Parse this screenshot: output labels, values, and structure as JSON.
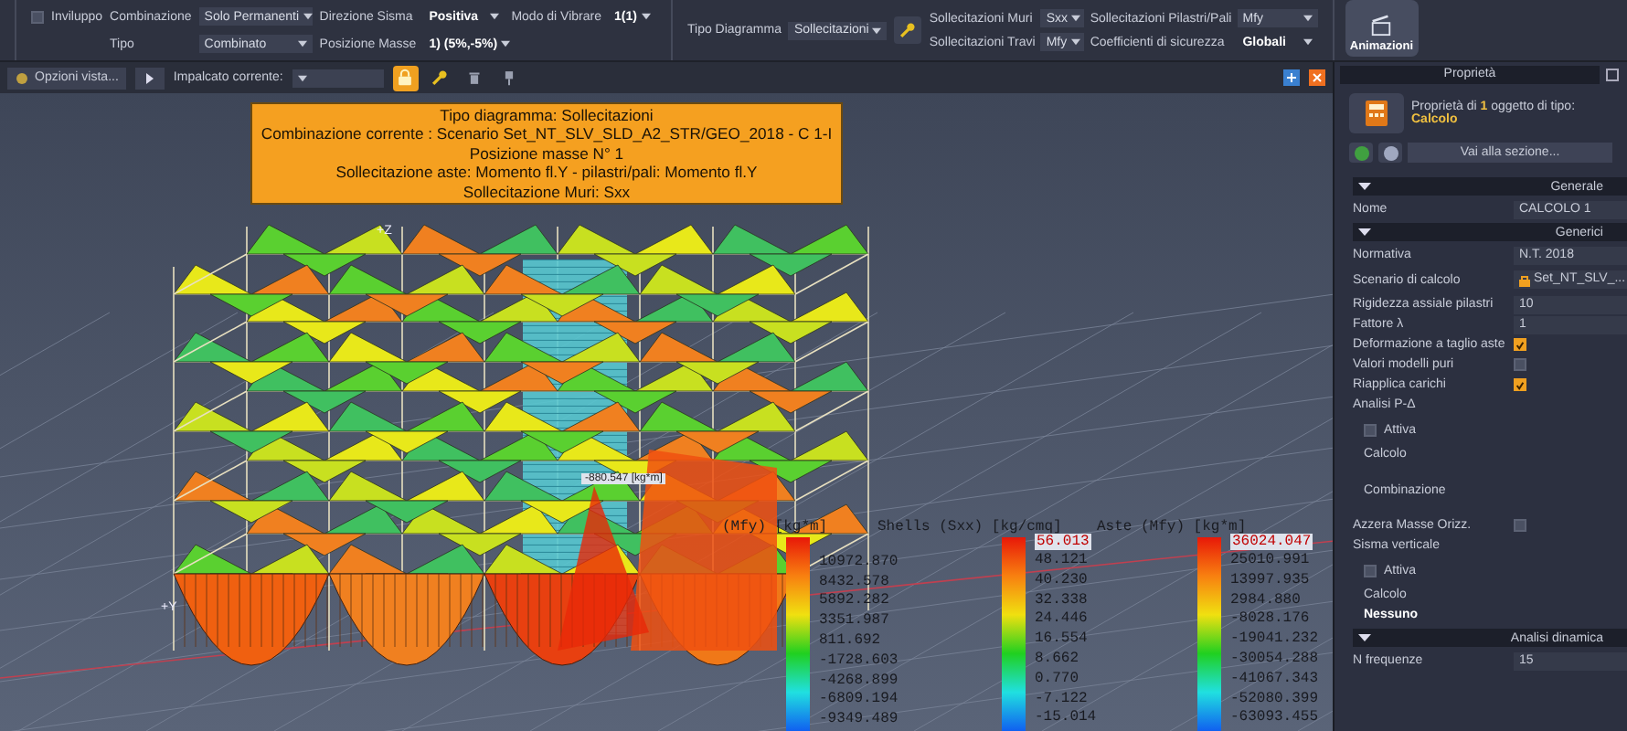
{
  "ribbon": {
    "envelope": {
      "label": "Inviluppo",
      "checked": false
    },
    "fields": [
      {
        "label": "Combinazione",
        "value": "Solo Permanenti"
      },
      {
        "label": "Direzione Sisma",
        "value": "Positiva"
      },
      {
        "label": "Modo di Vibrare",
        "value": "1(1)"
      },
      {
        "label": "Tipo",
        "value": "Combinato"
      },
      {
        "label": "Posizione Masse",
        "value": "1) (5%,-5%)"
      }
    ],
    "diagram_type": {
      "label": "Tipo Diagramma",
      "value": "Sollecitazioni"
    },
    "stress_fields": [
      {
        "label": "Sollecitazioni Muri",
        "value": "Sxx"
      },
      {
        "label": "Sollecitazioni Pilastri/Pali",
        "value": "Mfy"
      },
      {
        "label": "Sollecitazioni Travi",
        "value": "Mfy"
      },
      {
        "label": "Coefficienti di sicurezza",
        "value": "Globali"
      }
    ],
    "animation_button": "Animazioni"
  },
  "toolbar": {
    "view_options": "Opzioni vista...",
    "floor_label": "Impalcato corrente:",
    "tools": [
      {
        "kind": "lock",
        "selected": true
      },
      {
        "kind": "wrench",
        "selected": false
      },
      {
        "kind": "trash",
        "selected": false
      },
      {
        "kind": "pin",
        "selected": false
      }
    ]
  },
  "viewport": {
    "info_box": [
      "Tipo diagramma: Sollecitazioni",
      "Combinazione corrente : Scenario Set_NT_SLV_SLD_A2_STR/GEO_2018 - C 1-I",
      "Posizione masse N° 1",
      "Sollecitazione aste: Momento fl.Y - pilastri/pali: Momento fl.Y",
      "Sollecitazione Muri: Sxx"
    ],
    "axis_labels": [
      "+Z",
      "+Y"
    ],
    "value_label": "-880.547 [kg*m]",
    "legends": [
      {
        "title": "(Mfy) [kg*m]",
        "values": [
          "10972.870",
          "8432.578",
          "5892.282",
          "3351.987",
          "811.692",
          "-1728.603",
          "-4268.899",
          "-6809.194",
          "-9349.489"
        ]
      },
      {
        "title": "Shells (Sxx) [kg/cmq]",
        "max": "56.013",
        "values": [
          "48.121",
          "40.230",
          "32.338",
          "24.446",
          "16.554",
          "8.662",
          "0.770",
          "-7.122",
          "-15.014"
        ]
      },
      {
        "title": "Aste (Mfy) [kg*m]",
        "max": "36024.047",
        "values": [
          "25010.991",
          "13997.935",
          "2984.880",
          "-8028.176",
          "-19041.232",
          "-30054.288",
          "-41067.343",
          "-52080.399",
          "-63093.455"
        ]
      }
    ]
  },
  "properties": {
    "title": "Proprietà",
    "summary": "Proprietà di **1** oggetto di tipo:",
    "object_type": "Calcolo",
    "goto": "Vai alla sezione...",
    "rows": [
      {
        "kind": "section",
        "label": "Generale"
      },
      {
        "kind": "value",
        "label": "Nome",
        "value": "CALCOLO 1"
      },
      {
        "kind": "section",
        "label": "Generici"
      },
      {
        "kind": "value",
        "label": "Normativa",
        "value": "N.T. 2018"
      },
      {
        "kind": "scenario",
        "label": "Scenario di calcolo",
        "value": "Set_NT_SLV_..."
      },
      {
        "kind": "value",
        "label": "Rigidezza assiale pilastri",
        "value": "10"
      },
      {
        "kind": "value",
        "label": "Fattore λ",
        "value": "1"
      },
      {
        "kind": "check",
        "label": "Deformazione a taglio aste",
        "checked": true
      },
      {
        "kind": "check",
        "label": "Valori modelli puri",
        "checked": false
      },
      {
        "kind": "check",
        "label": "Riapplica carichi",
        "checked": true
      },
      {
        "kind": "label",
        "label": "Analisi P-Δ"
      },
      {
        "kind": "subcheck",
        "label": "Attiva",
        "checked": false
      },
      {
        "kind": "sublabel",
        "label": "Calcolo"
      },
      {
        "kind": "subfield",
        "label": "Combinazione"
      },
      {
        "kind": "check",
        "label": "Azzera Masse Orizz.",
        "checked": false
      },
      {
        "kind": "label",
        "label": "Sisma verticale"
      },
      {
        "kind": "subcheck",
        "label": "Attiva",
        "checked": false
      },
      {
        "kind": "sublabel",
        "label": "Calcolo"
      },
      {
        "kind": "subvalue",
        "label": "Nessuno"
      },
      {
        "kind": "section",
        "label": "Analisi dinamica"
      },
      {
        "kind": "value",
        "label": "N frequenze",
        "value": "15"
      }
    ]
  }
}
